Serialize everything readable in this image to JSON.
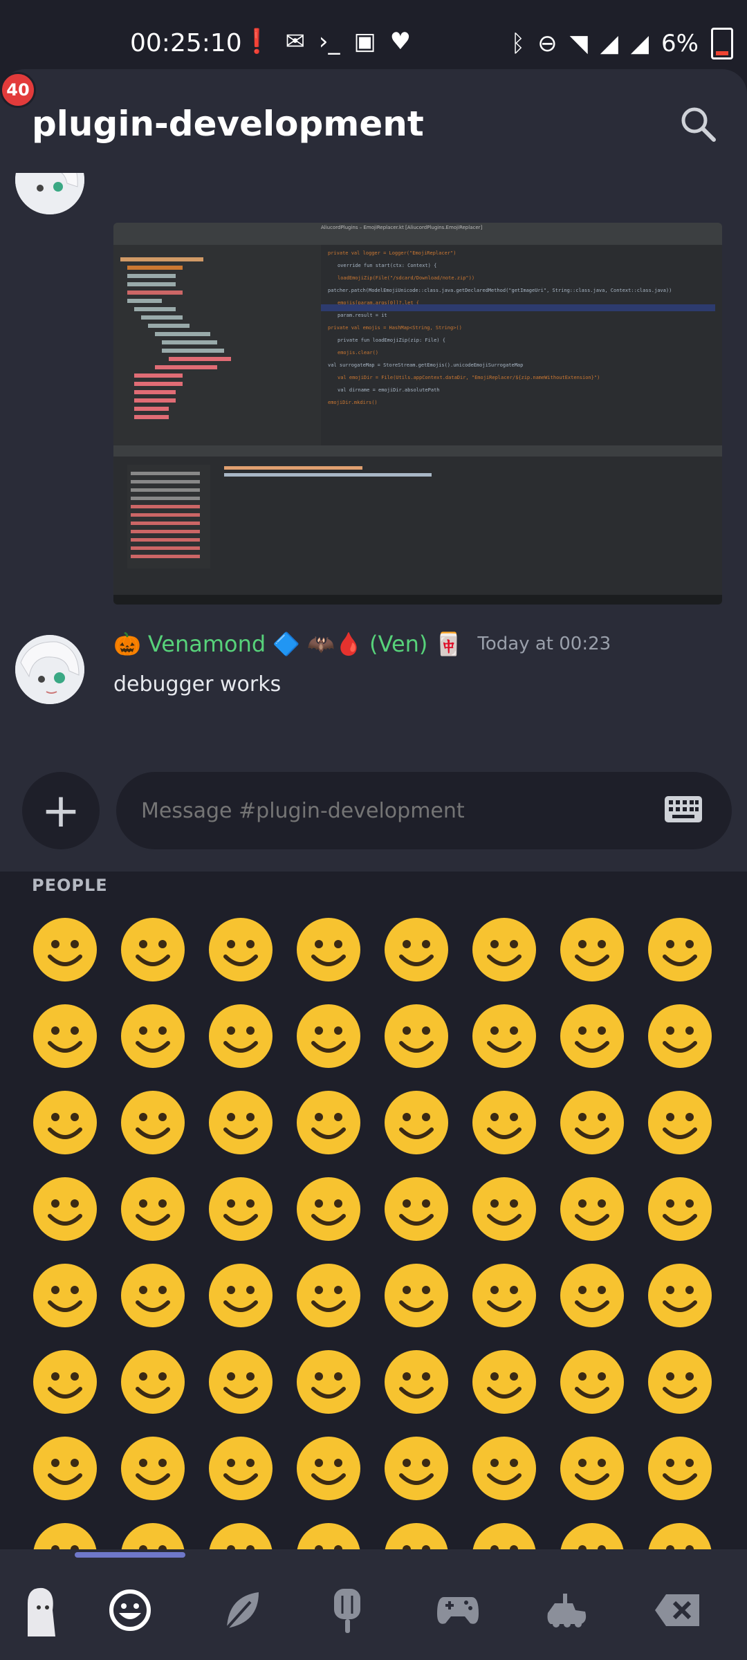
{
  "status_bar": {
    "time": "00:25:10",
    "battery": "6%",
    "icons": [
      "alert-icon",
      "mail-icon",
      "terminal-icon",
      "robot-icon",
      "heart-icon",
      "bluetooth-icon",
      "dnd-icon",
      "wifi-icon",
      "signal-x-icon",
      "signal-icon",
      "battery-icon"
    ]
  },
  "header": {
    "badge_count": "40",
    "channel_title": "plugin-development",
    "search_icon": "search-icon"
  },
  "attachment": {
    "ide_title": "AliucordPlugins – EmojiReplacer.kt [AliucordPlugins.EmojiReplacer]",
    "ide_lines": [
      "private val logger = Logger(\"EmojiReplacer\")",
      "override fun start(ctx: Context) {",
      "loadEmojiZip(File(\"/sdcard/Download/note.zip\"))",
      "patcher.patch(ModelEmojiUnicode::class.java.getDeclaredMethod(\"getImageUri\", String::class.java, Context::class.java))",
      "emojis[param.args[0]]?.let {",
      "param.result = it",
      "private val emojis = HashMap<String, String>()",
      "private fun loadEmojiZip(zip: File) {",
      "emojis.clear()",
      "val surrogateMap = StoreStream.getEmojis().unicodeEmojiSurrogateMap",
      "val emojiDir = File(Utils.appContext.dataDir, \"EmojiReplacer/${zip.nameWithoutExtension}\")",
      "val dirname = emojiDir.absolutePath",
      "emojiDir.mkdirs()"
    ]
  },
  "message": {
    "author_prefix": "🎃",
    "author": "Venamond",
    "author_suffix": "🔷 🦇🩸 (Ven) 🀄",
    "timestamp": "Today at 00:23",
    "text": "debugger works"
  },
  "composer": {
    "add_label": "+",
    "placeholder": "Message #plugin-development"
  },
  "emoji_picker": {
    "section": "PEOPLE",
    "emojis": [
      "😀",
      "😃",
      "😄",
      "😁",
      "😆",
      "😅",
      "😂",
      "🤣",
      "☺️",
      "😊",
      "😇",
      "🙂",
      "🙃",
      "😉",
      "😌",
      "🥲",
      "😍",
      "🥰",
      "😘",
      "😗",
      "😙",
      "😚",
      "😋",
      "😛",
      "😝",
      "😜",
      "🤪",
      "🤨",
      "🧐",
      "🤓",
      "😎",
      "🤩",
      "🥳",
      "😏",
      "😒",
      "😞",
      "😔",
      "😟",
      "😕",
      "🙁",
      "☹️",
      "😣",
      "😖",
      "😫",
      "😩",
      "🥺",
      "😢",
      "😭",
      "😤",
      "😮‍💨",
      "😠",
      "😡",
      "🤬",
      "🤯",
      "😳",
      "🤯",
      "🥵",
      "🥶",
      "😱",
      "😨",
      "😰",
      "😥",
      "😓",
      "🤗"
    ]
  },
  "categories": [
    "recent-icon",
    "people-icon",
    "nature-icon",
    "food-icon",
    "activity-icon",
    "travel-icon",
    "backspace-icon"
  ],
  "colors": {
    "background": "#1e1f29",
    "panel": "#2a2c38",
    "author": "#57d27a",
    "badge": "#e23b3b",
    "indicator": "#6f78c9",
    "emoji_face": "#f7c330"
  }
}
